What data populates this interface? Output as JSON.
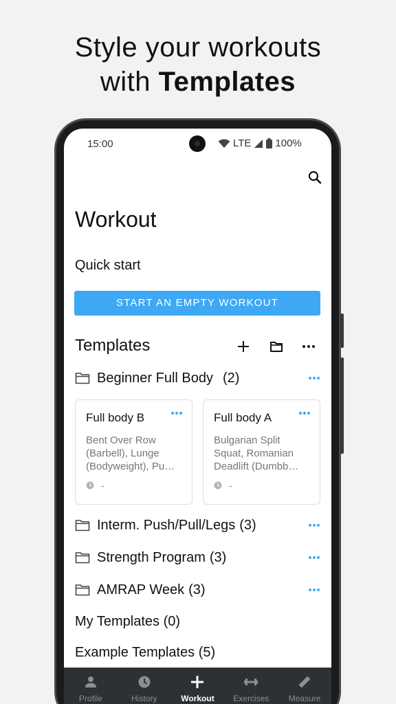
{
  "headline": {
    "line1": "Style your workouts",
    "line2_prefix": "with ",
    "line2_bold": "Templates"
  },
  "status_bar": {
    "time": "15:00",
    "network": "LTE",
    "battery": "100%"
  },
  "page": {
    "title": "Workout",
    "quick_start_label": "Quick start",
    "start_button_label": "START AN EMPTY WORKOUT",
    "templates_heading": "Templates"
  },
  "folders": [
    {
      "name": "Beginner Full Body",
      "count": "(2)"
    },
    {
      "name": "Interm. Push/Pull/Legs",
      "count": "(3)"
    },
    {
      "name": "Strength Program",
      "count": "(3)"
    },
    {
      "name": "AMRAP Week",
      "count": "(3)"
    }
  ],
  "cards": [
    {
      "name": "Full body B",
      "description": "Bent Over Row (Barbell), Lunge (Bodyweight), Pu…",
      "duration": "-"
    },
    {
      "name": "Full body A",
      "description": "Bulgarian Split Squat, Romanian Deadlift (Dumbb…",
      "duration": "-"
    }
  ],
  "sections": {
    "my_templates": "My Templates (0)",
    "example_templates": "Example Templates (5)"
  },
  "nav": [
    {
      "label": "Profile",
      "icon": "person-icon"
    },
    {
      "label": "History",
      "icon": "clock-icon"
    },
    {
      "label": "Workout",
      "icon": "plus-icon"
    },
    {
      "label": "Exercises",
      "icon": "dumbbell-icon"
    },
    {
      "label": "Measure",
      "icon": "ruler-icon"
    }
  ],
  "colors": {
    "accent": "#3ea8f4",
    "nav_bg": "#2d3136",
    "nav_active": "#ffffff",
    "nav_inactive": "#8a8f95"
  }
}
